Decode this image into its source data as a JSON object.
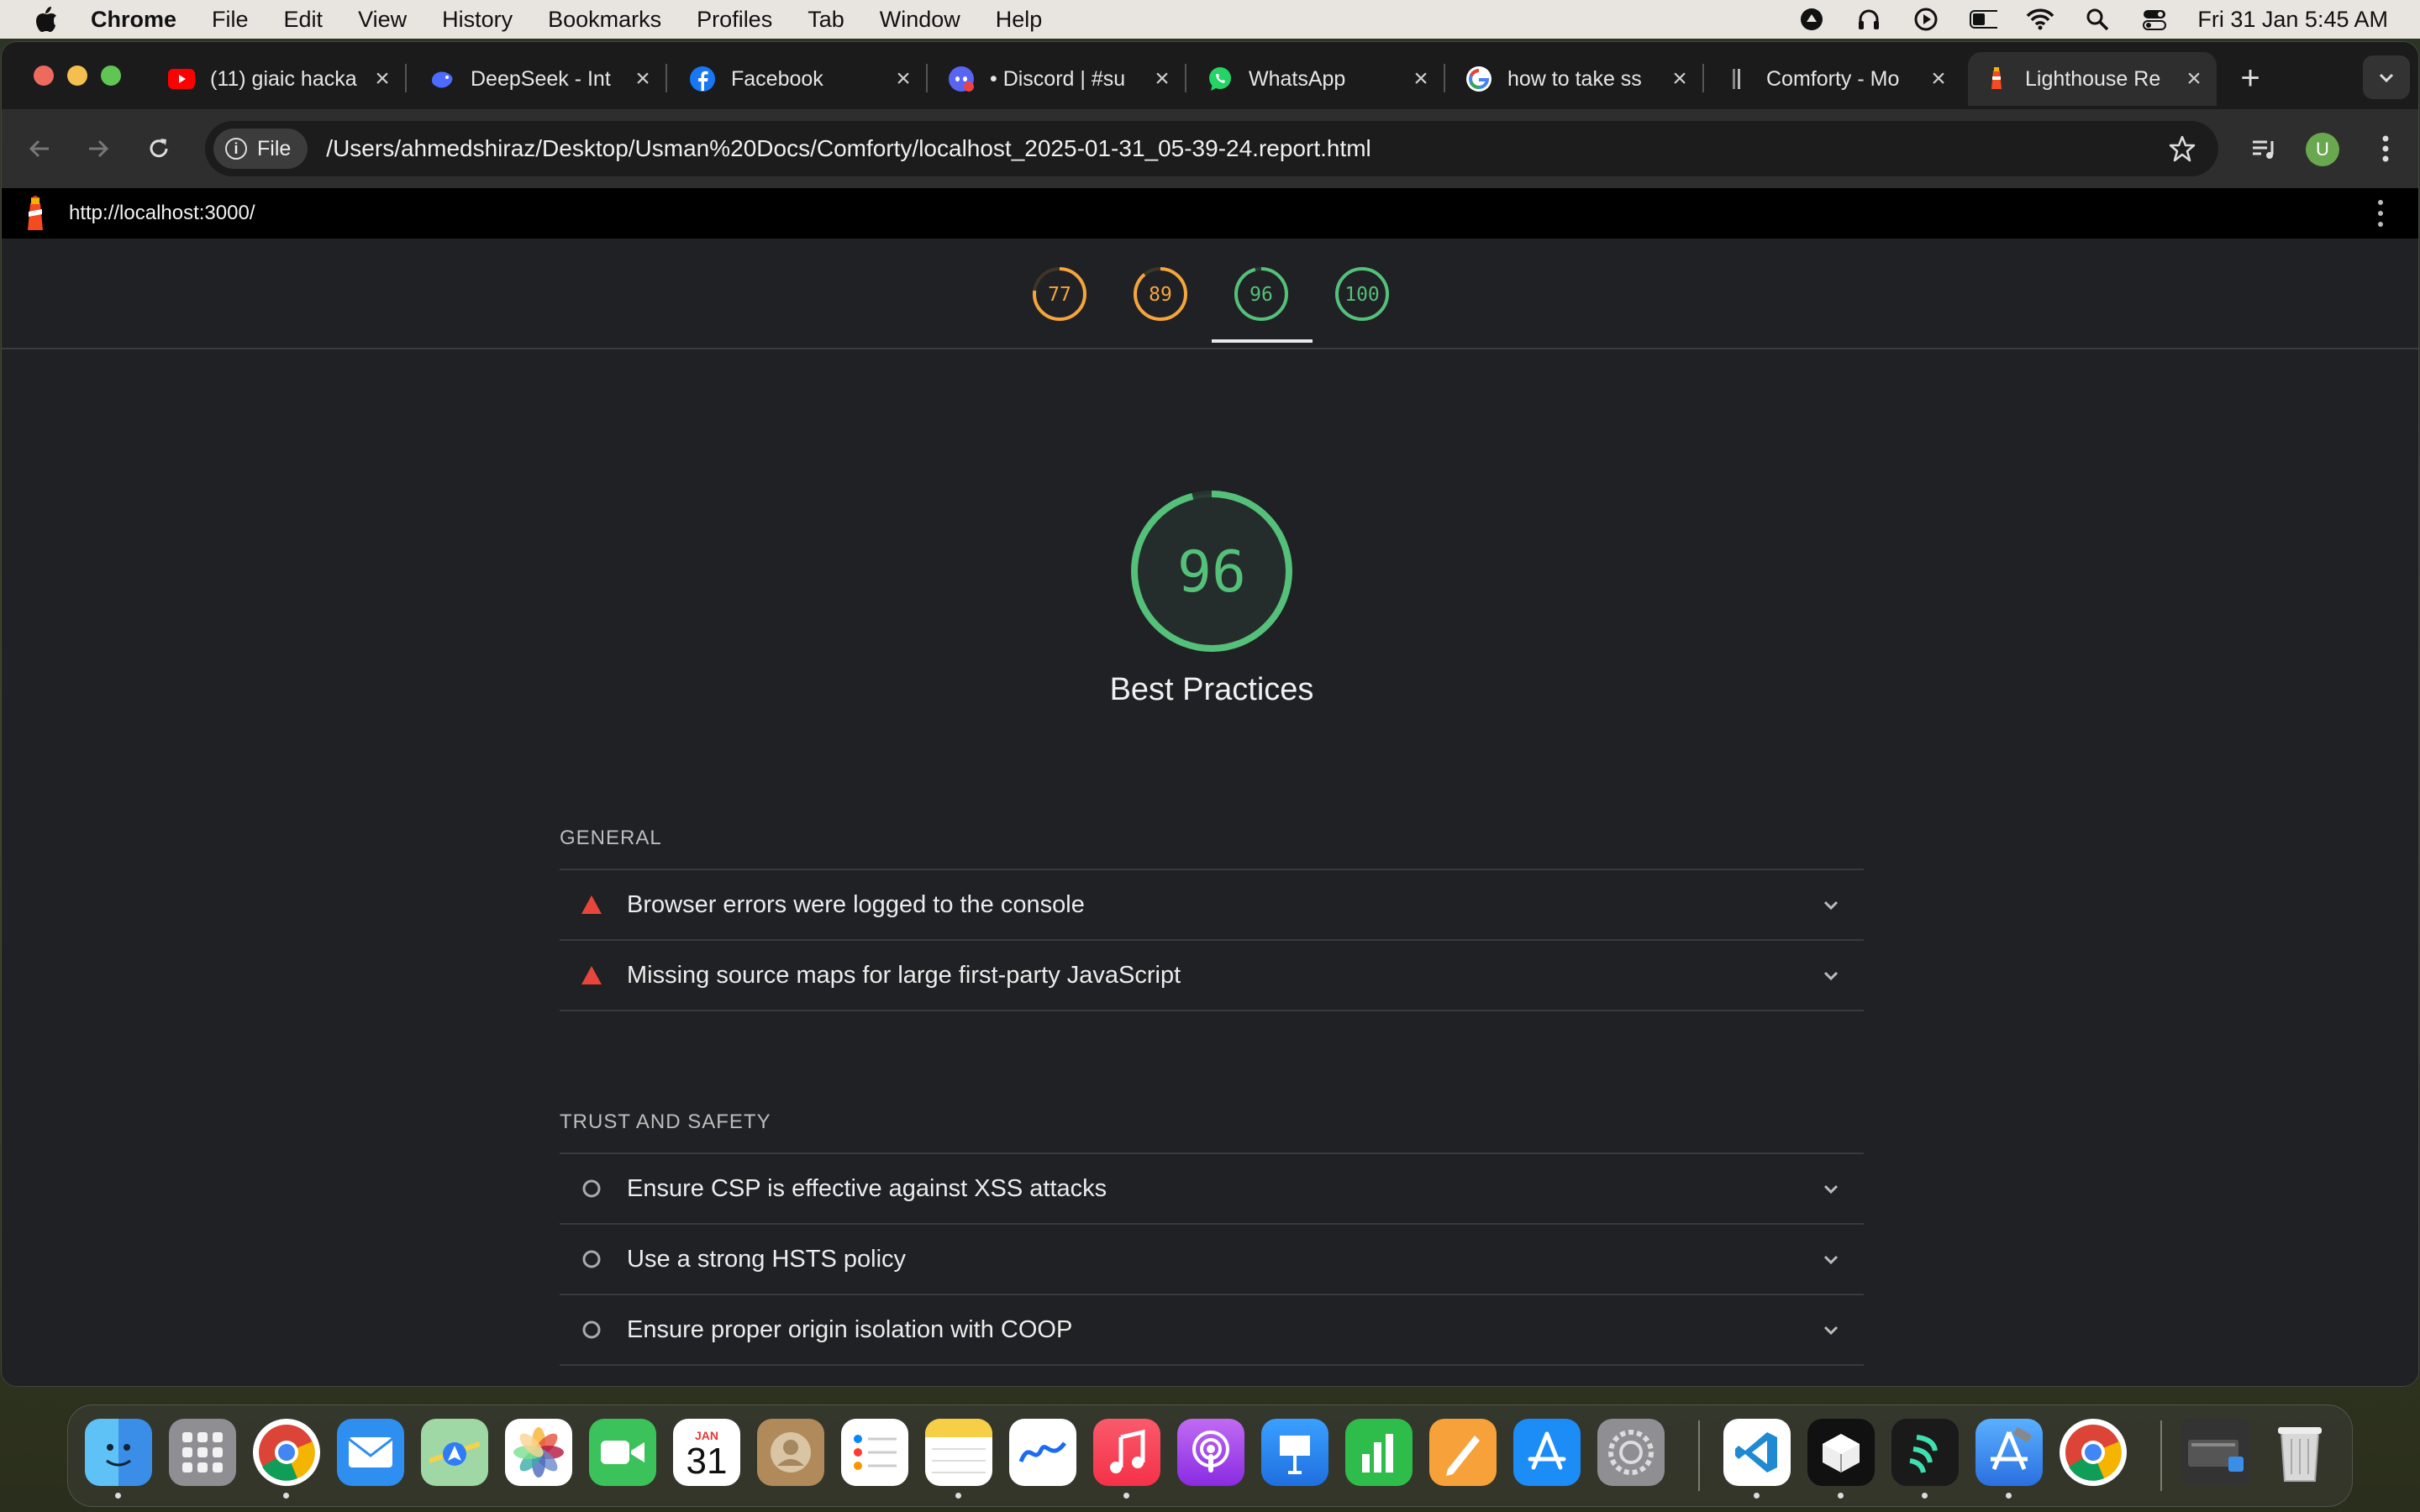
{
  "menubar": {
    "app_name": "Chrome",
    "items": [
      "File",
      "Edit",
      "View",
      "History",
      "Bookmarks",
      "Profiles",
      "Tab",
      "Window",
      "Help"
    ],
    "clock": "Fri 31 Jan  5:45 AM"
  },
  "tabs": [
    {
      "title": "(11) giaic hacka",
      "icon": "youtube-icon"
    },
    {
      "title": "DeepSeek - Int",
      "icon": "deepseek-icon"
    },
    {
      "title": "Facebook",
      "icon": "facebook-icon"
    },
    {
      "title": "• Discord | #su",
      "icon": "discord-icon"
    },
    {
      "title": "WhatsApp",
      "icon": "whatsapp-icon"
    },
    {
      "title": "how to take ss",
      "icon": "google-icon"
    },
    {
      "title": "Comforty - Mo",
      "icon": "comforty-icon"
    },
    {
      "title": "Lighthouse Re",
      "icon": "lighthouse-icon",
      "active": true
    }
  ],
  "omnibox": {
    "chip_label": "File",
    "url": "/Users/ahmedshiraz/Desktop/Usman%20Docs/Comforty/localhost_2025-01-31_05-39-24.report.html"
  },
  "profile": {
    "initial": "U"
  },
  "lighthouse": {
    "page_url": "http://localhost:3000/",
    "scores": [
      {
        "value": 77,
        "color": "#f4a53d"
      },
      {
        "value": 89,
        "color": "#f4a53d"
      },
      {
        "value": 96,
        "color": "#54c07a",
        "active": true
      },
      {
        "value": 100,
        "color": "#54c07a"
      }
    ],
    "main_score": 96,
    "main_color": "#54c07a",
    "category_title": "Best Practices",
    "groups": [
      {
        "title": "GENERAL",
        "audits": [
          {
            "label": "Browser errors were logged to the console",
            "status": "fail"
          },
          {
            "label": "Missing source maps for large first-party JavaScript",
            "status": "fail"
          }
        ]
      },
      {
        "title": "TRUST AND SAFETY",
        "audits": [
          {
            "label": "Ensure CSP is effective against XSS attacks",
            "status": "info"
          },
          {
            "label": "Use a strong HSTS policy",
            "status": "info"
          },
          {
            "label": "Ensure proper origin isolation with COOP",
            "status": "info"
          }
        ]
      }
    ]
  },
  "dock": {
    "apps": [
      "finder-icon",
      "launchpad-icon",
      "chrome-icon",
      "mail-icon",
      "maps-icon",
      "photos-icon",
      "facetime-icon",
      "calendar-icon",
      "contacts-icon",
      "reminders-icon",
      "notes-icon",
      "freeform-icon",
      "music-icon",
      "podcasts-icon",
      "keynote-icon",
      "numbers-icon",
      "pages-icon",
      "app-store-icon",
      "system-settings-icon",
      "vscode-icon",
      "cube-app-icon",
      "app-icon",
      "xcode-icon",
      "chrome-icon",
      "downloads-stack-icon",
      "trash-icon"
    ],
    "calendar_month": "JAN",
    "calendar_day": "31"
  },
  "colors": {
    "fail": "#e8453c",
    "pass": "#54c07a",
    "average": "#f4a53d"
  }
}
